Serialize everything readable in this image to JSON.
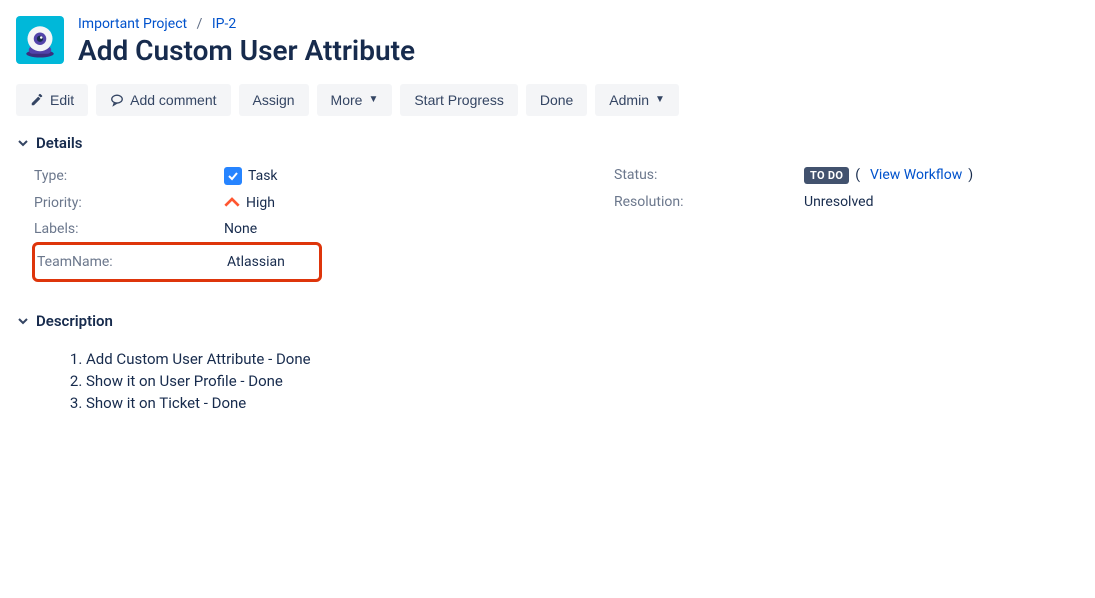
{
  "breadcrumbs": {
    "project": "Important Project",
    "issueKey": "IP-2"
  },
  "title": "Add Custom User Attribute",
  "toolbar": {
    "edit": "Edit",
    "addComment": "Add comment",
    "assign": "Assign",
    "more": "More",
    "startProgress": "Start Progress",
    "done": "Done",
    "admin": "Admin"
  },
  "sections": {
    "details": "Details",
    "description": "Description"
  },
  "details": {
    "left": {
      "typeLabel": "Type:",
      "typeValue": "Task",
      "priorityLabel": "Priority:",
      "priorityValue": "High",
      "labelsLabel": "Labels:",
      "labelsValue": "None",
      "teamNameLabel": "TeamName:",
      "teamNameValue": "Atlassian"
    },
    "right": {
      "statusLabel": "Status:",
      "statusLozenge": "TO DO",
      "workflowLink": "View Workflow",
      "resolutionLabel": "Resolution:",
      "resolutionValue": "Unresolved"
    }
  },
  "description": {
    "items": [
      "Add Custom User Attribute -  Done",
      "Show it on User Profile -   Done",
      "Show it on Ticket -  Done"
    ]
  }
}
